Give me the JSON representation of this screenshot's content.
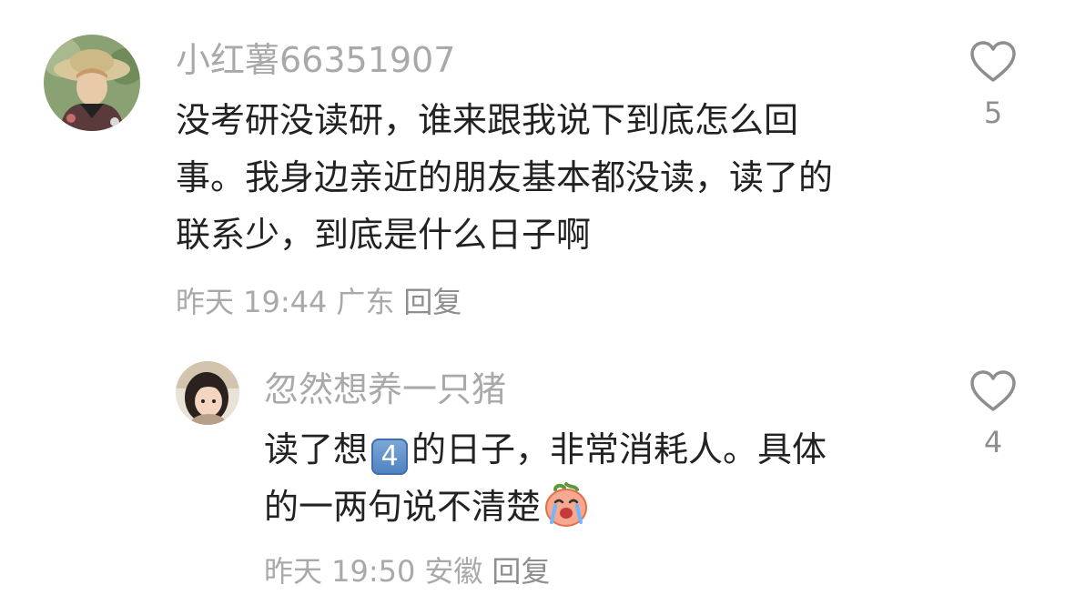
{
  "comments": [
    {
      "username": "小红薯66351907",
      "content_lines": [
        "没考研没读研，谁来跟我说下到底怎么回",
        "事。我身边亲近的朋友基本都没读，读了的",
        "联系少，到底是什么日子啊"
      ],
      "time": "昨天 19:44",
      "location": "广东",
      "reply_label": "回复",
      "like_count": "5",
      "icons": {
        "like": "heart-outline-icon"
      }
    },
    {
      "username": "忽然想养一只猪",
      "content_line1_before": "读了想",
      "content_badge": "4",
      "content_line1_after": "的日子，非常消耗人。具体",
      "content_line2": "的一两句说不清楚",
      "time": "昨天 19:50",
      "location": "安徽",
      "reply_label": "回复",
      "like_count": "4",
      "icons": {
        "like": "heart-outline-icon",
        "sticker": "crying-peach-sticker",
        "badge": "keycap-digit-icon"
      }
    }
  ],
  "colors": {
    "username": "#a9a9a9",
    "content": "#222222",
    "meta": "#a9a9a9",
    "like_icon": "#8e8e8e",
    "background": "#ffffff"
  }
}
